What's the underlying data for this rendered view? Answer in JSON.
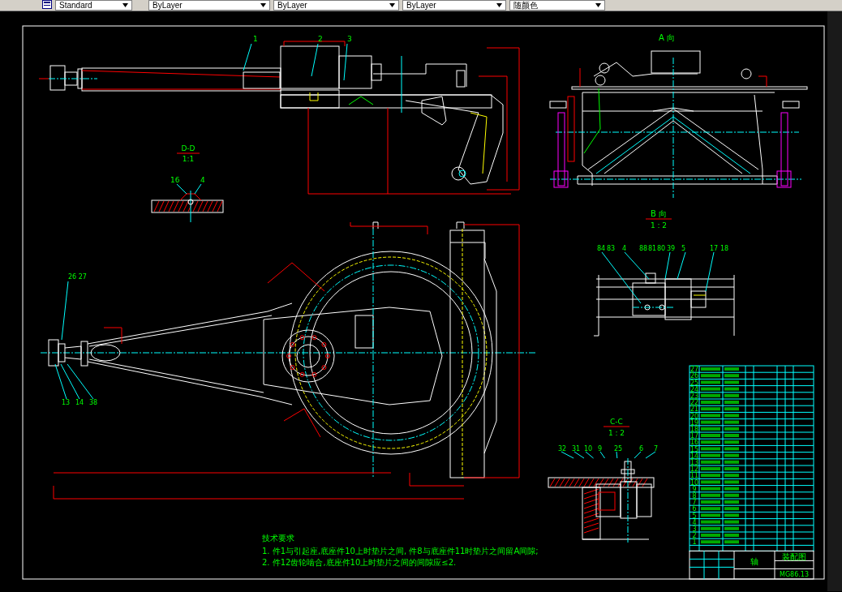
{
  "toolbar": {
    "text_style": "Standard",
    "layer_dropdowns": [
      "ByLayer",
      "ByLayer",
      "ByLayer"
    ],
    "color_dropdown": "随颜色"
  },
  "views": [
    {
      "title": "A 向"
    },
    {
      "title": "D-D",
      "scale": "1:1"
    },
    {
      "title": "B 向",
      "scale": "1 : 2"
    },
    {
      "title": "C-C",
      "scale": "1 : 2"
    }
  ],
  "balloons": {
    "front": [
      "1",
      "2",
      "3"
    ],
    "d_section": [
      "16",
      "4"
    ],
    "plan": [
      "26  27",
      "13",
      "14",
      "38"
    ],
    "b_section": [
      "84",
      "83",
      "4",
      "88",
      "81",
      "80",
      "39",
      "5",
      "17",
      "18"
    ],
    "c_section": [
      "32",
      "31",
      "10",
      "9",
      "25",
      "6",
      "7"
    ]
  },
  "notes": {
    "title": "技术要求",
    "lines": [
      "1. 件1与引起座,底座件10上时垫片之间, 件8与底座件11时垫片之间留A间隙;",
      "2. 件12齿轮啮合,底座件10上时垫片之间的间隙应≤2."
    ]
  },
  "parts_list": {
    "rows": [
      {
        "no": "27"
      },
      {
        "no": "26"
      },
      {
        "no": "25"
      },
      {
        "no": "24"
      },
      {
        "no": "23"
      },
      {
        "no": "22"
      },
      {
        "no": "21"
      },
      {
        "no": "20"
      },
      {
        "no": "19"
      },
      {
        "no": "18"
      },
      {
        "no": "17"
      },
      {
        "no": "16"
      },
      {
        "no": "15"
      },
      {
        "no": "14"
      },
      {
        "no": "13"
      },
      {
        "no": "12"
      },
      {
        "no": "11"
      },
      {
        "no": "10"
      },
      {
        "no": "9"
      },
      {
        "no": "8"
      },
      {
        "no": "7"
      },
      {
        "no": "6"
      },
      {
        "no": "5"
      },
      {
        "no": "4"
      },
      {
        "no": "3"
      },
      {
        "no": "2"
      },
      {
        "no": "1"
      }
    ]
  },
  "title_block": {
    "name": "轴",
    "drawing_title": "装配图",
    "drawing_number": "MG86.13"
  }
}
